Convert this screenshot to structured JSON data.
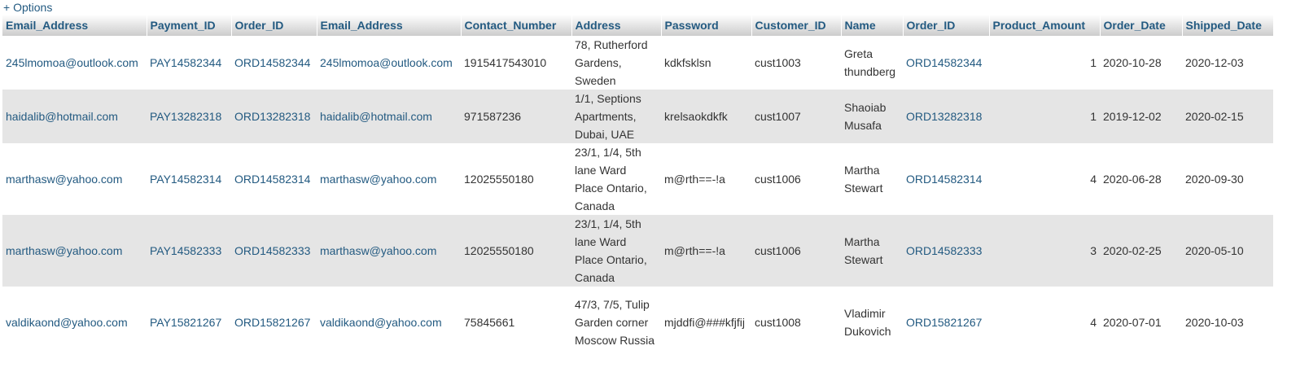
{
  "options": {
    "label": "+ Options"
  },
  "table": {
    "columns": [
      "Email_Address",
      "Payment_ID",
      "Order_ID",
      "Email_Address",
      "Contact_Number",
      "Address",
      "Password",
      "Customer_ID",
      "Name",
      "Order_ID",
      "Product_Amount",
      "Order_Date",
      "Shipped_Date"
    ],
    "rows": [
      {
        "email1": "245lmomoa@outlook.com",
        "payment_id": "PAY14582344",
        "order_id1": "ORD14582344",
        "email2": "245lmomoa@outlook.com",
        "contact": "1915417543010",
        "address": "78, Rutherford Gardens, Sweden",
        "password": "kdkfsklsn",
        "customer_id": "cust1003",
        "name": "Greta thundberg",
        "order_id2": "ORD14582344",
        "amount": "1",
        "order_date": "2020-10-28",
        "shipped_date": "2020-12-03"
      },
      {
        "email1": "haidalib@hotmail.com",
        "payment_id": "PAY13282318",
        "order_id1": "ORD13282318",
        "email2": "haidalib@hotmail.com",
        "contact": "971587236",
        "address": "1/1, Septions Apartments, Dubai, UAE",
        "password": "krelsaokdkfk",
        "customer_id": "cust1007",
        "name": "Shaoiab Musafa",
        "order_id2": "ORD13282318",
        "amount": "1",
        "order_date": "2019-12-02",
        "shipped_date": "2020-02-15"
      },
      {
        "email1": "marthasw@yahoo.com",
        "payment_id": "PAY14582314",
        "order_id1": "ORD14582314",
        "email2": "marthasw@yahoo.com",
        "contact": "12025550180",
        "address": "23/1, 1/4, 5th lane Ward Place Ontario, Canada",
        "password": "m@rth==-!a",
        "customer_id": "cust1006",
        "name": "Martha Stewart",
        "order_id2": "ORD14582314",
        "amount": "4",
        "order_date": "2020-06-28",
        "shipped_date": "2020-09-30"
      },
      {
        "email1": "marthasw@yahoo.com",
        "payment_id": "PAY14582333",
        "order_id1": "ORD14582333",
        "email2": "marthasw@yahoo.com",
        "contact": "12025550180",
        "address": "23/1, 1/4, 5th lane Ward Place Ontario, Canada",
        "password": "m@rth==-!a",
        "customer_id": "cust1006",
        "name": "Martha Stewart",
        "order_id2": "ORD14582333",
        "amount": "3",
        "order_date": "2020-02-25",
        "shipped_date": "2020-05-10"
      },
      {
        "email1": "valdikaond@yahoo.com",
        "payment_id": "PAY15821267",
        "order_id1": "ORD15821267",
        "email2": "valdikaond@yahoo.com",
        "contact": "75845661",
        "address": "47/3, 7/5, Tulip Garden corner Moscow Russia",
        "password": "mjddfi@###kfjfij",
        "customer_id": "cust1008",
        "name": "Vladimir Dukovich",
        "order_id2": "ORD15821267",
        "amount": "4",
        "order_date": "2020-07-01",
        "shipped_date": "2020-10-03"
      }
    ]
  },
  "colors": {
    "link": "#235a81",
    "row_alt": "#e5e5e5",
    "text": "#333333"
  }
}
